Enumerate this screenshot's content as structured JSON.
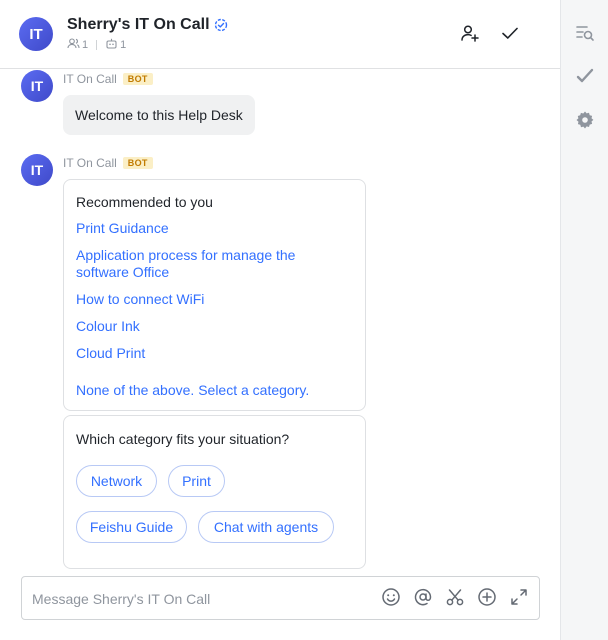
{
  "header": {
    "avatar_text": "IT",
    "title": "Sherry's IT On Call",
    "member_count": "1",
    "bot_count": "1",
    "icons": {
      "verified": "verified-badge-icon",
      "members": "members-icon",
      "bots": "bot-icon",
      "add_member": "add-member-icon",
      "done": "checkmark-icon"
    }
  },
  "sidebar": {
    "icons": [
      "search-messages-icon",
      "pencil-check-icon",
      "settings-gear-icon"
    ]
  },
  "messages": [
    {
      "avatar_text": "IT",
      "sender": "IT On Call",
      "tag": "BOT",
      "text": "Welcome to this Help Desk"
    },
    {
      "avatar_text": "IT",
      "sender": "IT On Call",
      "tag": "BOT",
      "card": {
        "heading": "Recommended to you",
        "links": [
          "Print Guidance",
          "Application process for manage the software Office",
          "How to connect WiFi",
          "Colour Ink",
          "Cloud Print",
          "None of the above. Select a category."
        ]
      },
      "category_card": {
        "heading": "Which category fits your situation?",
        "options": [
          "Network",
          "Print",
          "Feishu Guide",
          "Chat with agents"
        ]
      }
    }
  ],
  "composer": {
    "placeholder": "Message Sherry's IT On Call",
    "icons": [
      "emoji-icon",
      "mention-icon",
      "scissors-icon",
      "plus-circle-icon",
      "expand-icon"
    ]
  },
  "colors": {
    "accent": "#3370ff",
    "avatar": "#4f5bd5",
    "bot_tag_bg": "#fbefc6",
    "bot_tag_text": "#c17b00"
  }
}
